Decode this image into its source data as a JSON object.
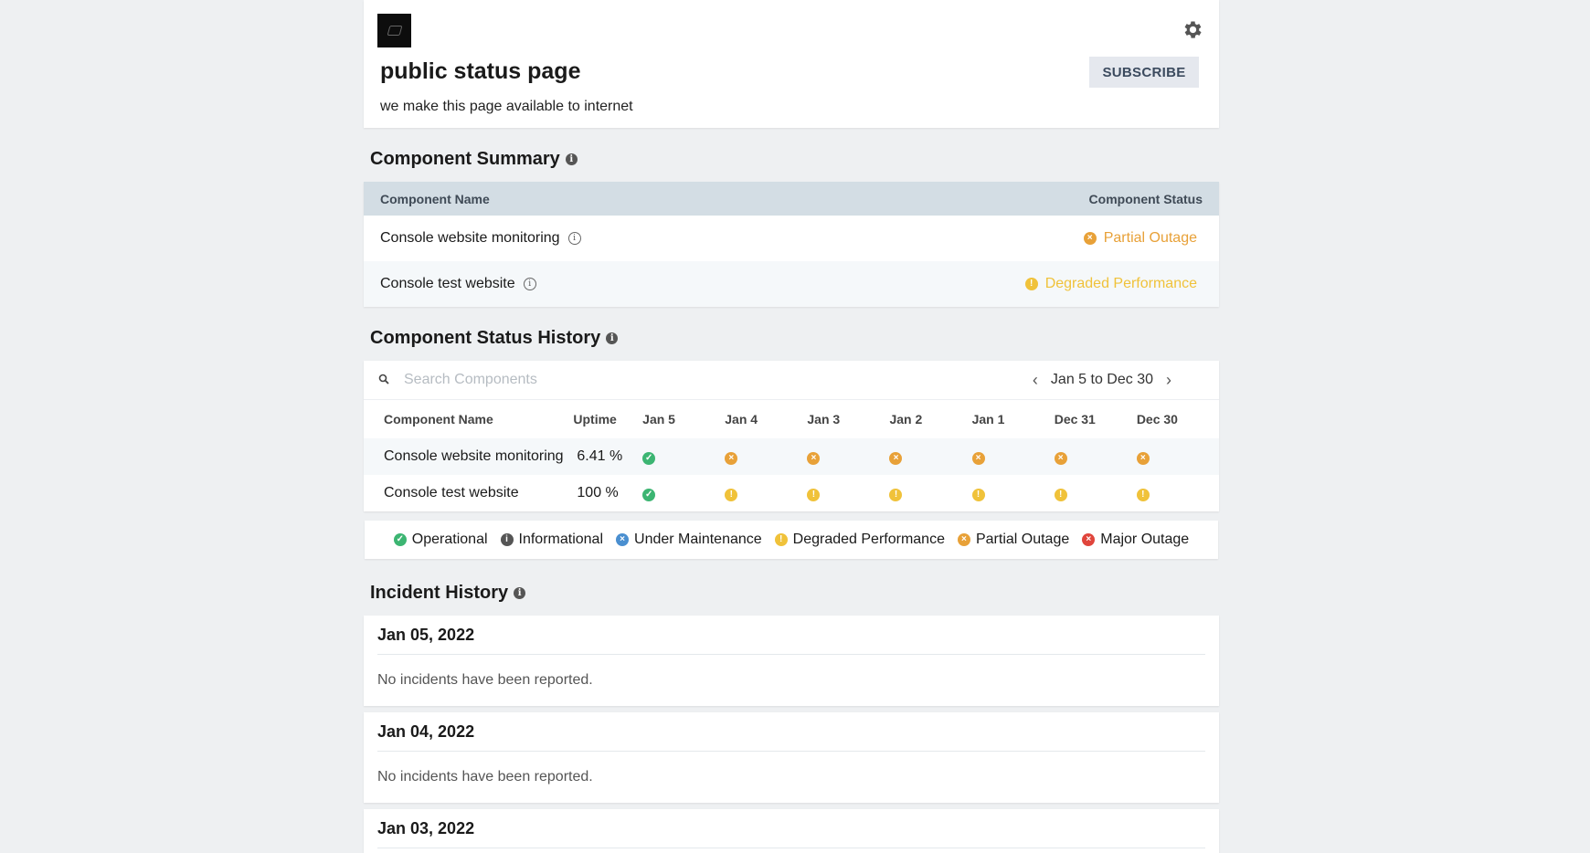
{
  "header": {
    "title": "public status page",
    "subtitle": "we make this page available to internet",
    "subscribe_label": "SUBSCRIBE"
  },
  "summary": {
    "title": "Component Summary",
    "col_name": "Component Name",
    "col_status": "Component Status",
    "rows": [
      {
        "name": "Console website monitoring",
        "status": "Partial Outage",
        "status_color": "#e8a138"
      },
      {
        "name": "Console test website",
        "status": "Degraded Performance",
        "status_color": "#f0c23a"
      }
    ]
  },
  "history": {
    "title": "Component Status History",
    "search_placeholder": "Search Components",
    "range_label": "Jan 5 to Dec 30",
    "col_name": "Component Name",
    "col_uptime": "Uptime",
    "dates": [
      "Jan 5",
      "Jan 4",
      "Jan 3",
      "Jan 2",
      "Jan 1",
      "Dec 31",
      "Dec 30"
    ],
    "rows": [
      {
        "name": "Console website monitoring",
        "uptime": "6.41 %",
        "statuses": [
          "operational",
          "partial",
          "partial",
          "partial",
          "partial",
          "partial",
          "partial"
        ]
      },
      {
        "name": "Console test website",
        "uptime": "100 %",
        "statuses": [
          "operational",
          "degraded",
          "degraded",
          "degraded",
          "degraded",
          "degraded",
          "degraded"
        ]
      }
    ]
  },
  "legend": [
    {
      "label": "Operational",
      "icon": "operational"
    },
    {
      "label": "Informational",
      "icon": "informational"
    },
    {
      "label": "Under Maintenance",
      "icon": "maintenance"
    },
    {
      "label": "Degraded Performance",
      "icon": "degraded"
    },
    {
      "label": "Partial Outage",
      "icon": "partial"
    },
    {
      "label": "Major Outage",
      "icon": "major"
    }
  ],
  "incidents": {
    "title": "Incident History",
    "days": [
      {
        "date": "Jan 05, 2022",
        "text": "No incidents have been reported."
      },
      {
        "date": "Jan 04, 2022",
        "text": "No incidents have been reported."
      },
      {
        "date": "Jan 03, 2022",
        "text": ""
      }
    ]
  },
  "colors": {
    "partial": "#e8a138",
    "degraded": "#f0c23a",
    "operational": "#3cb572",
    "informational": "#555555",
    "maintenance": "#4a8fd0",
    "major": "#e0453c"
  }
}
